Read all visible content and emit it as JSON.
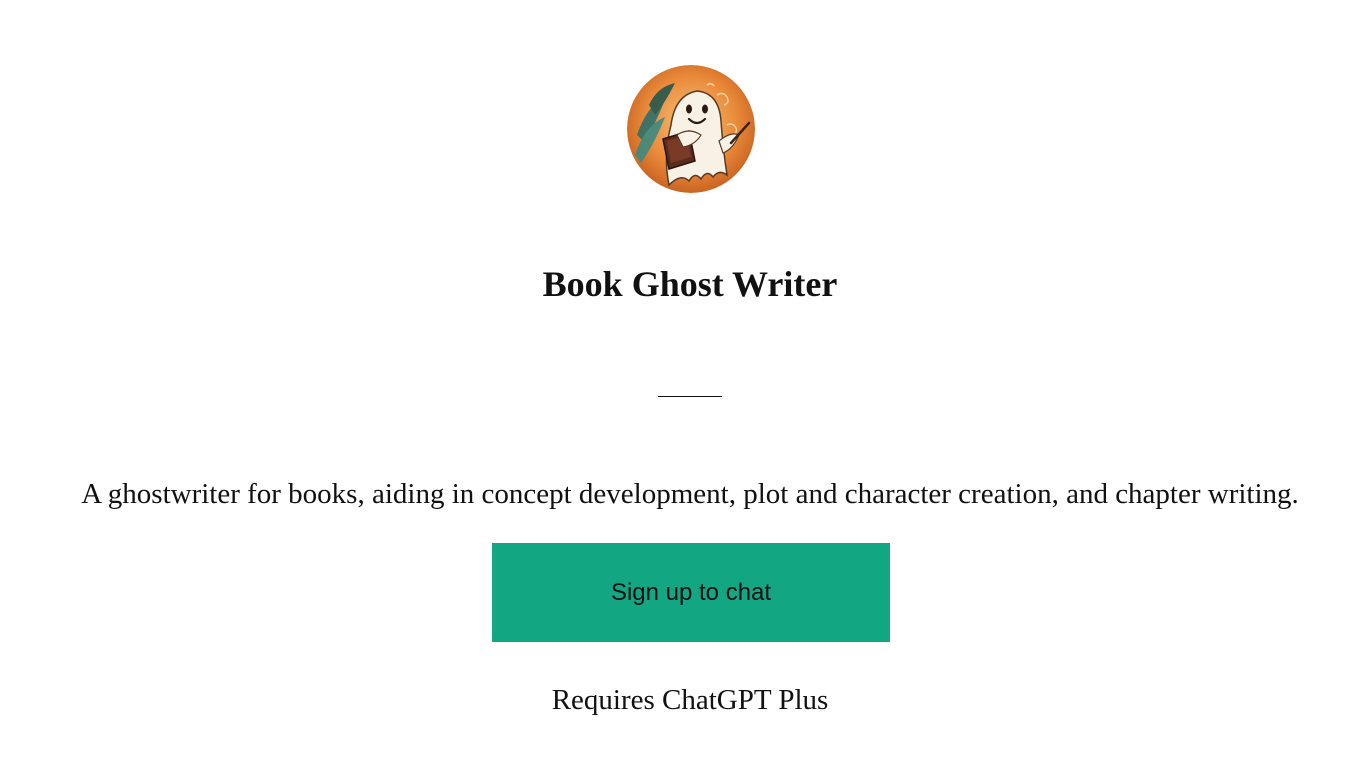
{
  "gpt": {
    "avatar_icon": "ghost-writer-avatar-icon",
    "title": "Book Ghost Writer",
    "description": "A ghostwriter for books, aiding in concept development, plot and character creation, and chapter writing.",
    "signup_label": "Sign up to chat",
    "requires_text": "Requires ChatGPT Plus"
  },
  "colors": {
    "button_background": "#13a683",
    "text": "#111111",
    "background": "#ffffff"
  }
}
